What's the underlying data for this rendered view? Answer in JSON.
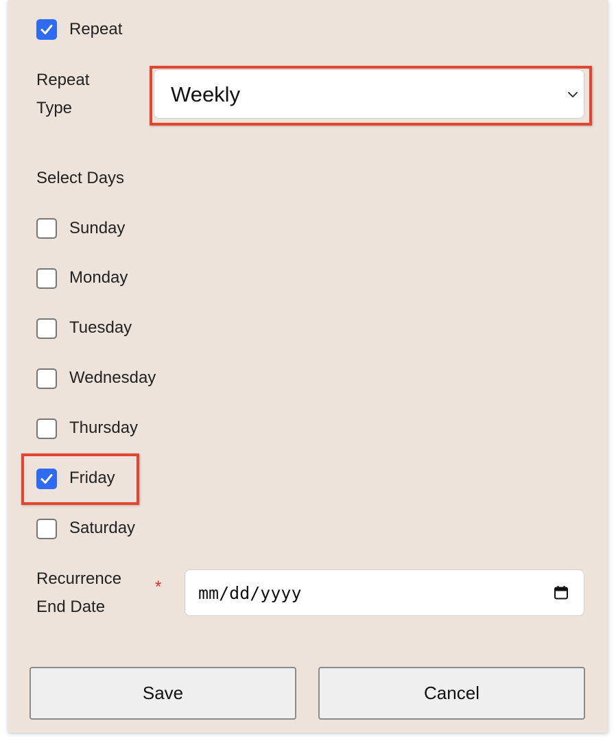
{
  "repeat": {
    "label": "Repeat",
    "checked": true
  },
  "repeat_type": {
    "label_line1": "Repeat",
    "label_line2": "Type",
    "selected": "Weekly",
    "icon": "chevron-down-icon"
  },
  "select_days": {
    "heading": "Select Days",
    "days": [
      {
        "label": "Sunday",
        "checked": false
      },
      {
        "label": "Monday",
        "checked": false
      },
      {
        "label": "Tuesday",
        "checked": false
      },
      {
        "label": "Wednesday",
        "checked": false
      },
      {
        "label": "Thursday",
        "checked": false
      },
      {
        "label": "Friday",
        "checked": true
      },
      {
        "label": "Saturday",
        "checked": false
      }
    ]
  },
  "recurrence_end_date": {
    "label_line1": "Recurrence",
    "label_line2": "End Date",
    "required_marker": "*",
    "placeholder": "mm/dd/yyyy",
    "icon": "calendar-icon"
  },
  "buttons": {
    "save": "Save",
    "cancel": "Cancel"
  },
  "colors": {
    "panel_background": "#ede3db",
    "checkbox_checked": "#2f6bf0",
    "highlight_border": "#e4452f",
    "required_marker": "#d93025"
  }
}
